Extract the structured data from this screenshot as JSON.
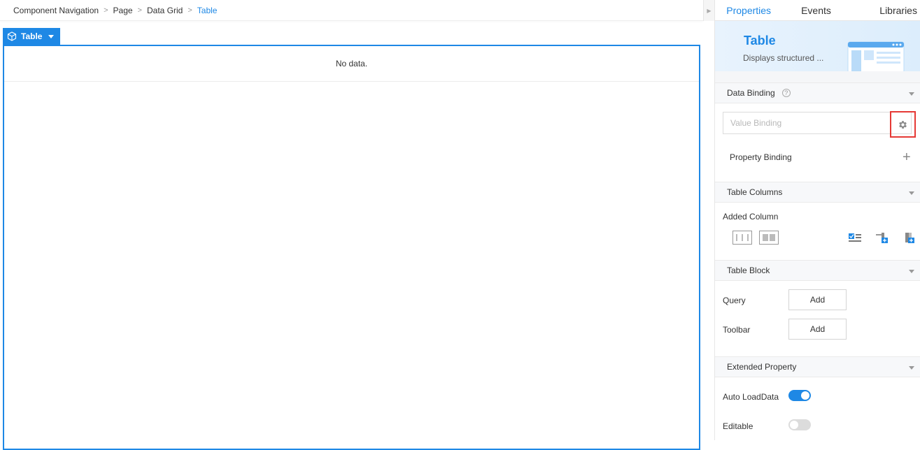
{
  "breadcrumb": {
    "items": [
      "Component Navigation",
      "Page",
      "Data Grid",
      "Table"
    ]
  },
  "canvas": {
    "component_tag": "Table",
    "empty_text": "No data."
  },
  "panel": {
    "tabs": [
      "Properties",
      "Events",
      "Libraries"
    ],
    "active_tab": "Properties",
    "hero": {
      "title": "Table",
      "description": "Displays structured ..."
    },
    "data_binding": {
      "title": "Data Binding",
      "help": "?",
      "value_placeholder": "Value Binding",
      "property_binding_label": "Property Binding"
    },
    "table_columns": {
      "title": "Table Columns",
      "added_column_label": "Added Column"
    },
    "table_block": {
      "title": "Table Block",
      "query_label": "Query",
      "query_button": "Add",
      "toolbar_label": "Toolbar",
      "toolbar_button": "Add"
    },
    "extended_property": {
      "title": "Extended Property",
      "auto_load_label": "Auto LoadData",
      "auto_load_on": true,
      "editable_label": "Editable",
      "editable_on": false
    }
  },
  "colors": {
    "accent": "#1e88e5",
    "highlight_border": "#e53935"
  },
  "icons": [
    "chevron-right-icon",
    "cube-icon",
    "caret-down-icon",
    "help-icon",
    "gear-icon",
    "plus-icon",
    "column-layout-icon",
    "checkbox-column-icon",
    "add-column-icon",
    "add-row-icon"
  ]
}
